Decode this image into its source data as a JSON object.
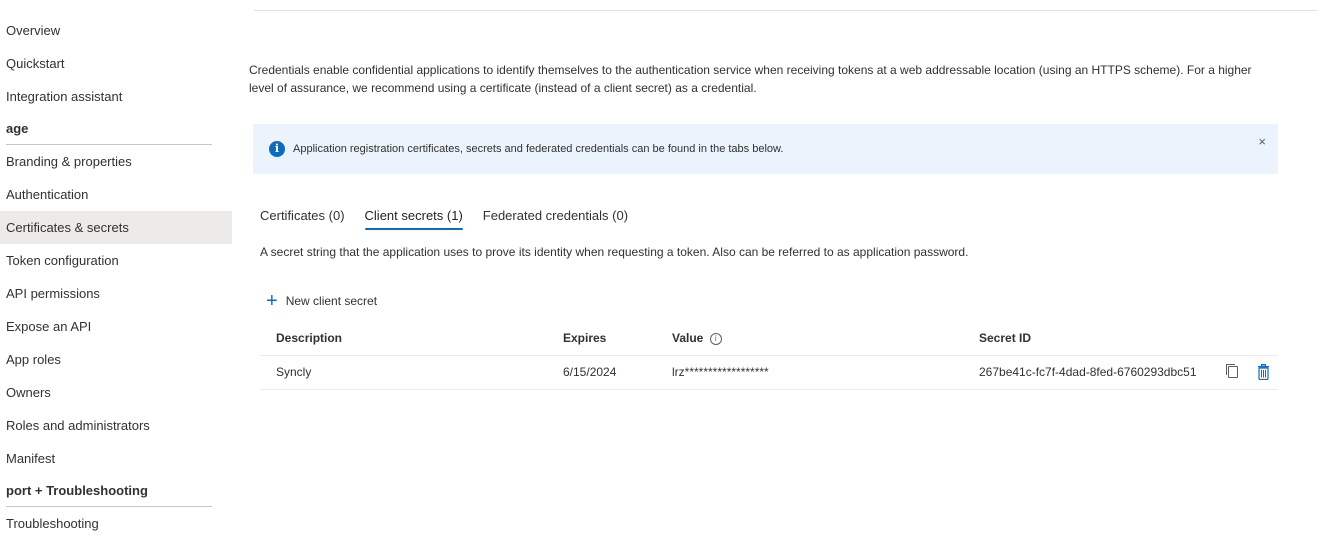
{
  "sidebar": {
    "items": [
      {
        "label": "Overview"
      },
      {
        "label": "Quickstart"
      },
      {
        "label": "Integration assistant"
      }
    ],
    "manage_section": "age",
    "manage_items": [
      {
        "label": "Branding & properties"
      },
      {
        "label": "Authentication"
      },
      {
        "label": "Certificates & secrets"
      },
      {
        "label": "Token configuration"
      },
      {
        "label": "API permissions"
      },
      {
        "label": "Expose an API"
      },
      {
        "label": "App roles"
      },
      {
        "label": "Owners"
      },
      {
        "label": "Roles and administrators"
      },
      {
        "label": "Manifest"
      }
    ],
    "support_section": "port + Troubleshooting",
    "support_items": [
      {
        "label": "Troubleshooting"
      }
    ]
  },
  "main": {
    "intro_text": "Credentials enable confidential applications to identify themselves to the authentication service when receiving tokens at a web addressable location (using an HTTPS scheme). For a higher level of assurance, we recommend using a certificate (instead of a client secret) as a credential.",
    "banner_text": "Application registration certificates, secrets and federated credentials can be found in the tabs below.",
    "banner_close": "×",
    "tabs": [
      {
        "label": "Certificates (0)"
      },
      {
        "label": "Client secrets (1)"
      },
      {
        "label": "Federated credentials (0)"
      }
    ],
    "tab_description": "A secret string that the application uses to prove its identity when requesting a token. Also can be referred to as application password.",
    "new_secret_label": "New client secret",
    "table": {
      "headers": {
        "description": "Description",
        "expires": "Expires",
        "value": "Value",
        "secret_id": "Secret ID"
      },
      "rows": [
        {
          "description": "Syncly",
          "expires": "6/15/2024",
          "value": "lrz******************",
          "secret_id": "267be41c-fc7f-4dad-8fed-6760293dbc51"
        }
      ]
    }
  },
  "colors": {
    "accent": "#0f6cbd",
    "active_nav_bg": "#edebe9",
    "banner_bg": "#ebf3fc"
  }
}
